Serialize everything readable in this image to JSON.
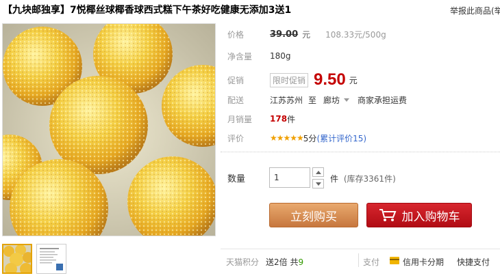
{
  "title": "【九块邮独享】7悦椰丝球椰香球西式糕下午茶好吃健康无添加3送1",
  "report_link": "举报此商品(举",
  "price": {
    "label": "价格",
    "original": "39.00",
    "unit": "元",
    "per_unit": "108.33元/500g"
  },
  "net_weight": {
    "label": "净含量",
    "value": "180g"
  },
  "promotion": {
    "label": "促销",
    "tag": "限时促销",
    "price": "9.50",
    "unit": "元"
  },
  "shipping": {
    "label": "配送",
    "from": "江苏苏州",
    "to_word": "至",
    "to": "廊坊",
    "fee": "商家承担运费"
  },
  "monthly_sales": {
    "label": "月销量",
    "count": "178",
    "unit": "件"
  },
  "rating": {
    "label": "评价",
    "stars": "★★★★★",
    "score": "5分",
    "reviews_text": "(累计评价15)"
  },
  "quantity": {
    "label": "数量",
    "value": "1",
    "unit": "件",
    "stock": "(库存3361件)"
  },
  "buttons": {
    "buy_now": "立刻购买",
    "add_to_cart": "加入购物车"
  },
  "points": {
    "label": "天猫积分",
    "text_prefix": "送2倍 共",
    "value": "9"
  },
  "payment": {
    "label": "支付",
    "credit_card": "信用卡分期",
    "quick_pay": "快捷支付"
  },
  "colors": {
    "promo_red": "#c40000",
    "buy_button": "#c7773e",
    "cart_button": "#b10c14",
    "star": "#f0a000"
  }
}
